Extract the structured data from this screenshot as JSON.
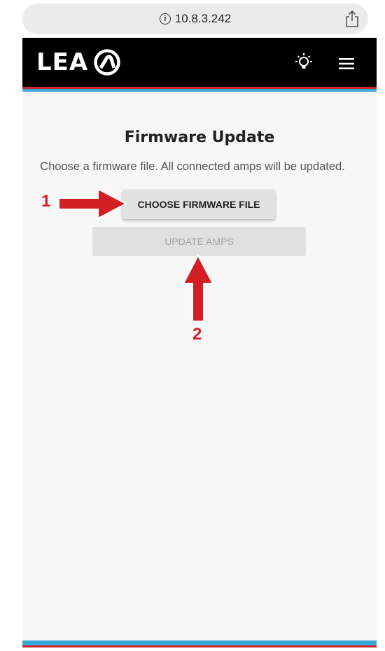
{
  "browser": {
    "url": "10.8.3.242",
    "info_icon": "ⓘ",
    "share_icon": "share-icon"
  },
  "header": {
    "logo_text": "LEA",
    "logo_icon": "lea-logo-mark",
    "bulb_icon": "lightbulb-icon",
    "menu_icon": "hamburger-menu-icon"
  },
  "colors": {
    "header_bg": "#000000",
    "stripe_red": "#d5252b",
    "stripe_blue": "#35a9d9",
    "annotation_red": "#d31e24"
  },
  "main": {
    "title": "Firmware Update",
    "subtitle": "Choose a firmware file. All connected amps will be updated.",
    "choose_button": "CHOOSE FIRMWARE FILE",
    "update_button": "UPDATE AMPS"
  },
  "annotations": {
    "step1": "1",
    "step2": "2"
  }
}
